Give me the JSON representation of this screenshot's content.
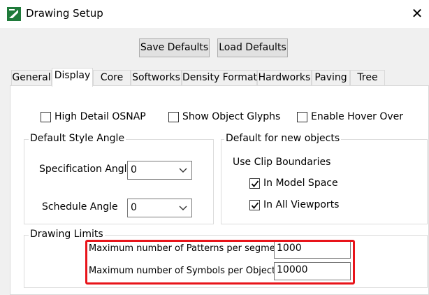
{
  "window": {
    "title": "Drawing Setup",
    "close_glyph": "✕"
  },
  "toolbar": {
    "save_defaults": "Save Defaults",
    "load_defaults": "Load Defaults"
  },
  "tabs": [
    {
      "label": "General",
      "active": false
    },
    {
      "label": "Display",
      "active": true
    },
    {
      "label": "Core",
      "active": false
    },
    {
      "label": "Softworks",
      "active": false
    },
    {
      "label": "Density Format",
      "active": false
    },
    {
      "label": "Hardworks",
      "active": false
    },
    {
      "label": "Paving",
      "active": false
    },
    {
      "label": "Tree",
      "active": false
    }
  ],
  "display": {
    "high_detail_osnap": {
      "label": "High Detail OSNAP",
      "checked": false
    },
    "show_object_glyphs": {
      "label": "Show Object Glyphs",
      "checked": false
    },
    "enable_hover_over": {
      "label": "Enable Hover Over",
      "checked": false
    },
    "style_angle": {
      "legend": "Default Style Angle",
      "specification_label": "Specification Angle",
      "specification_value": "0",
      "schedule_label": "Schedule Angle",
      "schedule_value": "0"
    },
    "new_objects": {
      "legend": "Default for new objects",
      "clip_label": "Use Clip Boundaries",
      "model_space": {
        "label": "In Model Space",
        "checked": true
      },
      "all_viewports": {
        "label": "In All Viewports",
        "checked": true
      }
    },
    "drawing_limits": {
      "legend": "Drawing Limits",
      "patterns_label": "Maximum number of Patterns per segment",
      "patterns_value": "1000",
      "symbols_label": "Maximum number of Symbols per Object",
      "symbols_value": "10000"
    }
  },
  "colors": {
    "highlight": "#e8141a",
    "check": "#000000"
  },
  "icons": {
    "app": "drawing-app-icon",
    "dropdown": "chevron-down-icon",
    "check": "checkmark-icon"
  }
}
